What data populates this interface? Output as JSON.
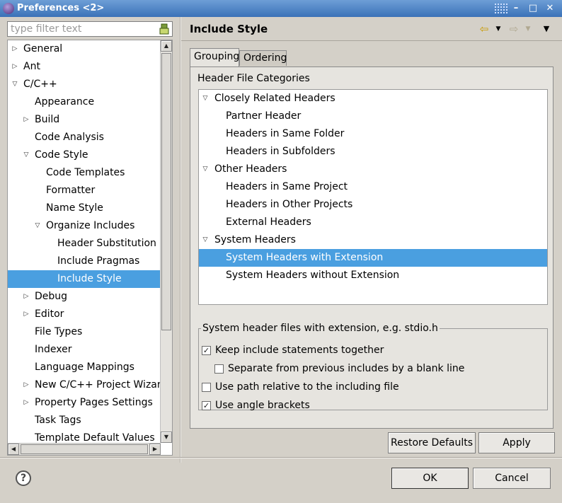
{
  "window": {
    "title": "Preferences  <2>",
    "controls": {
      "minimize": "–",
      "maximize": "□",
      "close": "✕"
    }
  },
  "filter": {
    "placeholder": "type filter text",
    "value": ""
  },
  "tree": {
    "items": [
      {
        "label": "General",
        "depth": 0,
        "expander": "collapsed"
      },
      {
        "label": "Ant",
        "depth": 0,
        "expander": "collapsed"
      },
      {
        "label": "C/C++",
        "depth": 0,
        "expander": "expanded"
      },
      {
        "label": "Appearance",
        "depth": 1,
        "expander": "none"
      },
      {
        "label": "Build",
        "depth": 1,
        "expander": "collapsed"
      },
      {
        "label": "Code Analysis",
        "depth": 1,
        "expander": "none"
      },
      {
        "label": "Code Style",
        "depth": 1,
        "expander": "expanded"
      },
      {
        "label": "Code Templates",
        "depth": 2,
        "expander": "none"
      },
      {
        "label": "Formatter",
        "depth": 2,
        "expander": "none"
      },
      {
        "label": "Name Style",
        "depth": 2,
        "expander": "none"
      },
      {
        "label": "Organize Includes",
        "depth": 2,
        "expander": "expanded"
      },
      {
        "label": "Header Substitution",
        "depth": 3,
        "expander": "none"
      },
      {
        "label": "Include Pragmas",
        "depth": 3,
        "expander": "none"
      },
      {
        "label": "Include Style",
        "depth": 3,
        "expander": "none",
        "selected": true
      },
      {
        "label": "Debug",
        "depth": 1,
        "expander": "collapsed"
      },
      {
        "label": "Editor",
        "depth": 1,
        "expander": "collapsed"
      },
      {
        "label": "File Types",
        "depth": 1,
        "expander": "none"
      },
      {
        "label": "Indexer",
        "depth": 1,
        "expander": "none"
      },
      {
        "label": "Language Mappings",
        "depth": 1,
        "expander": "none"
      },
      {
        "label": "New C/C++ Project Wizard",
        "depth": 1,
        "expander": "collapsed"
      },
      {
        "label": "Property Pages Settings",
        "depth": 1,
        "expander": "collapsed"
      },
      {
        "label": "Task Tags",
        "depth": 1,
        "expander": "none"
      },
      {
        "label": "Template Default Values",
        "depth": 1,
        "expander": "none"
      }
    ]
  },
  "page": {
    "title": "Include Style",
    "tabs": [
      {
        "label": "Grouping",
        "active": true
      },
      {
        "label": "Ordering",
        "active": false
      }
    ],
    "categories_label": "Header File Categories",
    "categories": [
      {
        "label": "Closely Related Headers",
        "depth": 0,
        "expander": "expanded"
      },
      {
        "label": "Partner Header",
        "depth": 1
      },
      {
        "label": "Headers in Same Folder",
        "depth": 1
      },
      {
        "label": "Headers in Subfolders",
        "depth": 1
      },
      {
        "label": "Other Headers",
        "depth": 0,
        "expander": "expanded"
      },
      {
        "label": "Headers in Same Project",
        "depth": 1
      },
      {
        "label": "Headers in Other Projects",
        "depth": 1
      },
      {
        "label": "External Headers",
        "depth": 1
      },
      {
        "label": "System Headers",
        "depth": 0,
        "expander": "expanded"
      },
      {
        "label": "System Headers with Extension",
        "depth": 1,
        "selected": true
      },
      {
        "label": "System Headers without Extension",
        "depth": 1
      }
    ],
    "group": {
      "legend": "System header files with extension, e.g. stdio.h",
      "options": [
        {
          "label": "Keep include statements together",
          "checked": true,
          "indent": 0
        },
        {
          "label": "Separate from previous includes by a blank line",
          "checked": false,
          "indent": 1
        },
        {
          "label": "Use path relative to the including file",
          "checked": false,
          "indent": 0
        },
        {
          "label": "Use angle brackets",
          "checked": true,
          "indent": 0
        }
      ]
    }
  },
  "buttons": {
    "restore_defaults": "Restore Defaults",
    "apply": "Apply",
    "ok": "OK",
    "cancel": "Cancel",
    "help": "?"
  }
}
